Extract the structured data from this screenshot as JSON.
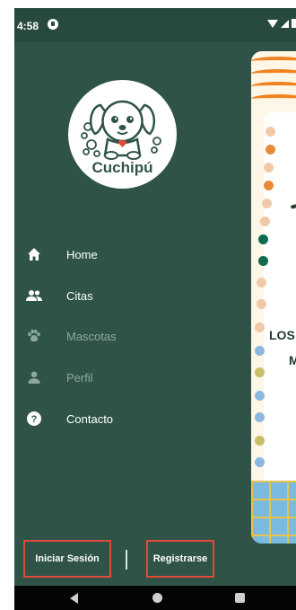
{
  "status_bar": {
    "time": "4:58"
  },
  "background_screen": {
    "partial_text_1": "LOS",
    "partial_text_2": "M"
  },
  "drawer": {
    "logo_text": "Cuchipú",
    "menu": [
      {
        "label": "Home",
        "icon": "home-icon",
        "enabled": true
      },
      {
        "label": "Citas",
        "icon": "people-icon",
        "enabled": true
      },
      {
        "label": "Mascotas",
        "icon": "paw-icon",
        "enabled": false
      },
      {
        "label": "Perfil",
        "icon": "person-icon",
        "enabled": false
      },
      {
        "label": "Contacto",
        "icon": "help-icon",
        "enabled": true
      }
    ],
    "login_label": "Iniciar Sesión",
    "register_label": "Registrarse"
  },
  "colors": {
    "drawer_bg": "#2f5447",
    "status_bg": "#284a3d",
    "highlight_border": "#e04a3a",
    "disabled_text": "#8fa89d"
  }
}
